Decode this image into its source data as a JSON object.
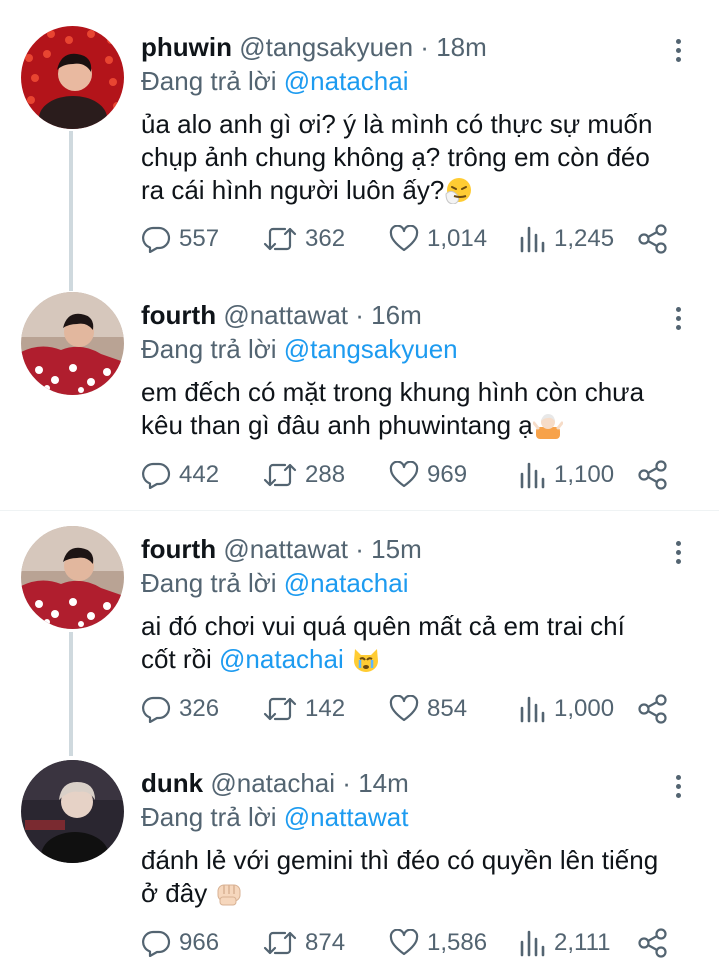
{
  "tweets": [
    {
      "name": "phuwin",
      "handle": "@tangsakyuen",
      "sep": "·",
      "time": "18m",
      "reply_prefix": "Đang trả lời ",
      "reply_to": "@natachai",
      "text_lines": [
        "ủa alo anh gì ơi? ý là mình có thực sự muốn",
        "chụp ảnh chung không ạ? trông em còn đéo",
        "ra cái hình người luôn ấy?"
      ],
      "emoji": "sneezing-face",
      "replies": "557",
      "retweets": "362",
      "likes": "1,014",
      "views": "1,245"
    },
    {
      "name": "fourth",
      "handle": "@nattawat",
      "sep": "·",
      "time": "16m",
      "reply_prefix": "Đang trả lời ",
      "reply_to": "@tangsakyuen",
      "text_lines": [
        "em đếch có mặt trong khung hình còn chưa",
        "kêu than gì đâu anh phuwintang ạ"
      ],
      "emoji": "person-shrugging",
      "replies": "442",
      "retweets": "288",
      "likes": "969",
      "views": "1,100"
    },
    {
      "name": "fourth",
      "handle": "@nattawat",
      "sep": "·",
      "time": "15m",
      "reply_prefix": "Đang trả lời ",
      "reply_to": "@natachai",
      "text_lines": [
        "ai đó chơi vui quá quên mất cả em trai chí",
        "cốt rồi "
      ],
      "text_mention": "@natachai",
      "emoji": "crying-cat",
      "replies": "326",
      "retweets": "142",
      "likes": "854",
      "views": "1,000"
    },
    {
      "name": "dunk",
      "handle": "@natachai",
      "sep": "·",
      "time": "14m",
      "reply_prefix": "Đang trả lời ",
      "reply_to": "@nattawat",
      "text_lines": [
        "đánh lẻ với gemini thì đéo có quyền lên tiếng",
        "ở đây "
      ],
      "emoji": "raised-fist",
      "replies": "966",
      "retweets": "874",
      "likes": "1,586",
      "views": "2,111"
    }
  ]
}
